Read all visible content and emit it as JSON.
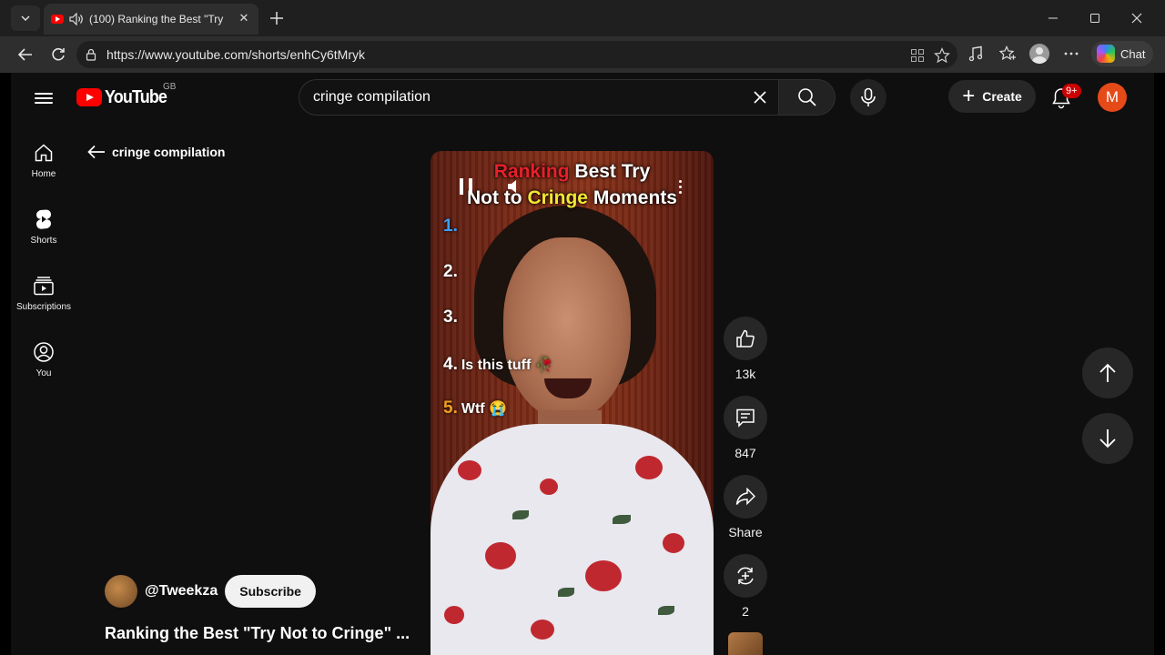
{
  "browser": {
    "tab_title": "(100) Ranking the Best \"Try Not to Cringe\" Moments",
    "url": "https://www.youtube.com/shorts/enhCy6tMryk",
    "chat_label": "Chat"
  },
  "youtube": {
    "logo_text": "YouTube",
    "country_code": "GB",
    "search": {
      "value": "cringe compilation"
    },
    "create_label": "Create",
    "notifications_badge": "9+",
    "avatar_letter": "M",
    "sidebar": [
      {
        "label": "Home",
        "icon": "home-icon"
      },
      {
        "label": "Shorts",
        "icon": "shorts-icon"
      },
      {
        "label": "Subscriptions",
        "icon": "subscriptions-icon"
      },
      {
        "label": "You",
        "icon": "you-icon"
      }
    ],
    "back_label": "cringe compilation",
    "short": {
      "overlay_title": {
        "part1": "Ranking",
        "part2": " Best Try",
        "part3": "Not to ",
        "part4": "Cringe",
        "part5": " Moments"
      },
      "ranks": [
        {
          "num": "1.",
          "text": ""
        },
        {
          "num": "2.",
          "text": ""
        },
        {
          "num": "3.",
          "text": ""
        },
        {
          "num": "4.",
          "text": "Is this tuff 🥀"
        },
        {
          "num": "5.",
          "text": "Wtf 😭"
        }
      ],
      "likes": "13k",
      "comments": "847",
      "share_label": "Share",
      "remix_count": "2",
      "channel": "@Tweekza",
      "subscribe_label": "Subscribe",
      "title": "Ranking the Best \"Try Not to Cringe\" ..."
    }
  },
  "colors": {
    "brand_red": "#ff0000",
    "avatar": "#e64a19",
    "accent_red_text": "#e8202a",
    "accent_yellow_text": "#f2e832"
  }
}
